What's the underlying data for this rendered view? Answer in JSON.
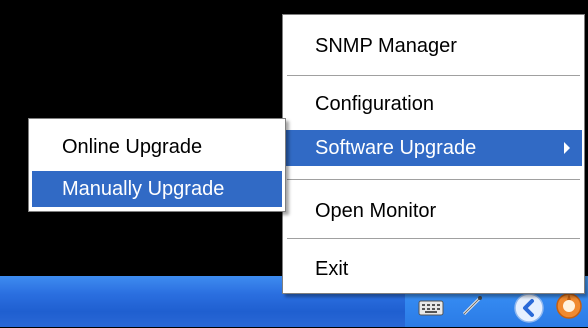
{
  "main_menu": {
    "items": [
      {
        "label": "SNMP Manager"
      },
      {
        "label": "Configuration"
      },
      {
        "label": "Software Upgrade",
        "selected": true
      },
      {
        "label": "Open Monitor"
      },
      {
        "label": "Exit"
      }
    ]
  },
  "sub_menu": {
    "items": [
      {
        "label": "Online Upgrade"
      },
      {
        "label": "Manually Upgrade",
        "selected": true
      }
    ]
  },
  "tray": {
    "icons": [
      "keyboard-icon",
      "pen-icon",
      "expand-tray-icon",
      "app-tray-icon"
    ]
  },
  "colors": {
    "selection": "#316ac5",
    "taskbar": "#2b6fe0",
    "background": "#000000"
  }
}
